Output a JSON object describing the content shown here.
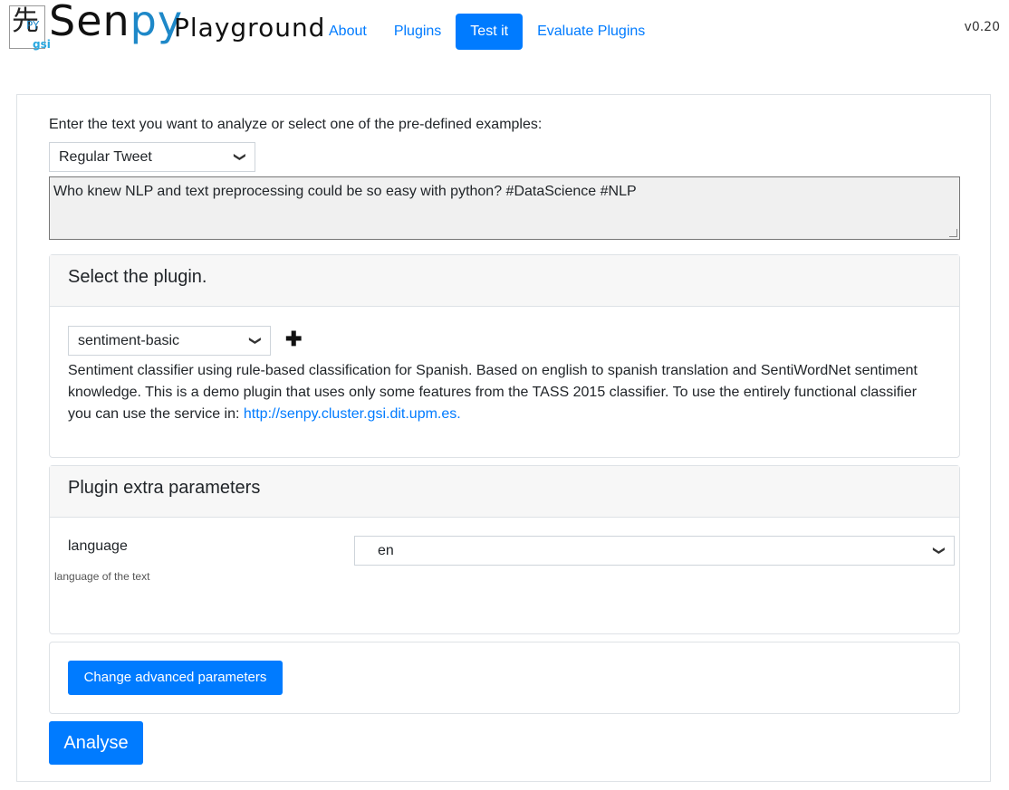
{
  "header": {
    "logo_sen": "Sen",
    "logo_py": "py",
    "logo_playground": "Playground",
    "logo_gsi": "gsi",
    "nav": [
      {
        "label": "About"
      },
      {
        "label": "Plugins"
      },
      {
        "label": "Test it",
        "active": true
      },
      {
        "label": "Evaluate Plugins"
      }
    ],
    "version": "v0.20"
  },
  "main": {
    "prompt": "Enter the text you want to analyze or select one of the pre-defined examples:",
    "example_select": "Regular Tweet",
    "input_text": "Who knew NLP and text preprocessing could be so easy with python? #DataScience #NLP",
    "plugin_card": {
      "title": "Select the plugin.",
      "selected_plugin": "sentiment-basic",
      "add_icon": "plus-icon",
      "description": "Sentiment classifier using rule-based classification for Spanish. Based on english to spanish translation and SentiWordNet sentiment knowledge. This is a demo plugin that uses only some features from the TASS 2015 classifier. To use the entirely functional classifier you can use the service in: ",
      "link": "http://senpy.cluster.gsi.dit.upm.es."
    },
    "params_card": {
      "title": "Plugin extra parameters",
      "param_name": "language",
      "param_help": "language of the text",
      "param_value": "en"
    },
    "advanced_button": "Change advanced parameters",
    "analyse_button": "Analyse"
  },
  "colors": {
    "accent": "#007bff",
    "card_header_bg": "#f7f7f7",
    "textarea_bg": "#f0f0f0"
  }
}
